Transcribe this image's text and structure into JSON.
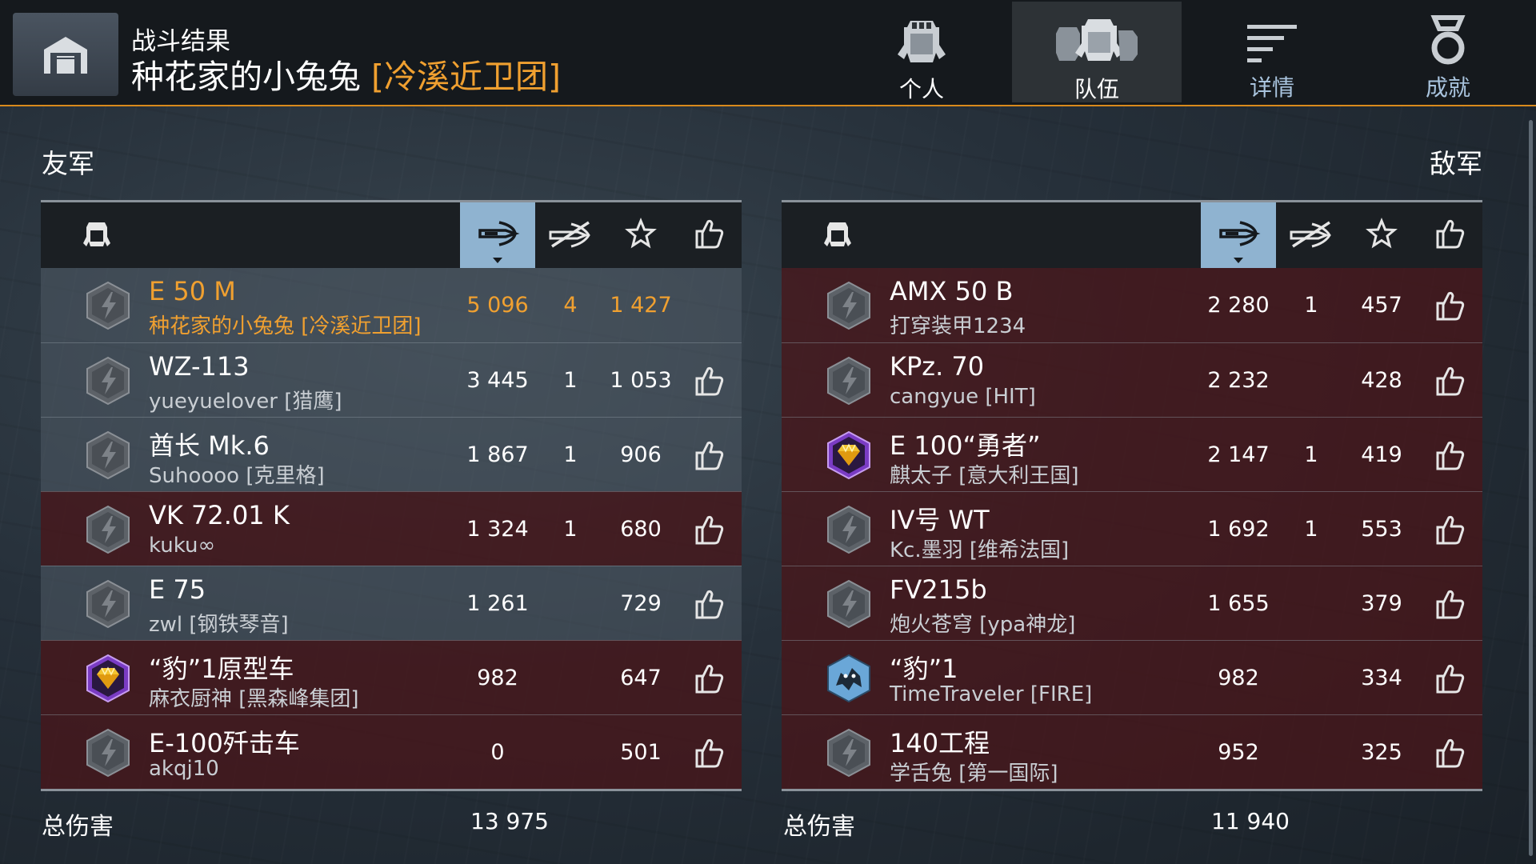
{
  "header": {
    "subtitle": "战斗结果",
    "player_name": "种花家的小兔兔",
    "clan": "[冷溪近卫团]",
    "tabs": [
      {
        "label": "个人",
        "icon": "single-helmet-icon",
        "active": false
      },
      {
        "label": "队伍",
        "icon": "team-helmets-icon",
        "active": true
      },
      {
        "label": "详情",
        "icon": "details-lines-icon",
        "active": false
      },
      {
        "label": "成就",
        "icon": "medal-icon",
        "active": false
      }
    ]
  },
  "allies": {
    "title": "友军",
    "total_label": "总伤害",
    "total_damage": "13 975",
    "rows": [
      {
        "tank": "E 50 M",
        "player": "种花家的小兔兔 [冷溪近卫团]",
        "damage": "5 096",
        "kills": "4",
        "xp": "1 427",
        "like": false,
        "badge": "grey",
        "style": "light",
        "me": true
      },
      {
        "tank": "WZ-113",
        "player": "yueyuelover [猎鹰]",
        "damage": "3 445",
        "kills": "1",
        "xp": "1 053",
        "like": true,
        "badge": "grey",
        "style": "light",
        "me": false
      },
      {
        "tank": "酋长 Mk.6",
        "player": "Suhoooo [克里格]",
        "damage": "1 867",
        "kills": "1",
        "xp": "906",
        "like": true,
        "badge": "grey",
        "style": "light",
        "me": false
      },
      {
        "tank": "VK 72.01 K",
        "player": "kuku∞",
        "damage": "1 324",
        "kills": "1",
        "xp": "680",
        "like": true,
        "badge": "grey",
        "style": "dark",
        "me": false
      },
      {
        "tank": "E 75",
        "player": "zwl [钢铁琴音]",
        "damage": "1 261",
        "kills": "",
        "xp": "729",
        "like": true,
        "badge": "grey",
        "style": "light",
        "me": false
      },
      {
        "tank": "“豹”1原型车",
        "player": "麻衣厨神 [黑森峰集团]",
        "damage": "982",
        "kills": "",
        "xp": "647",
        "like": true,
        "badge": "gold",
        "style": "dark",
        "me": false
      },
      {
        "tank": "E-100歼击车",
        "player": "akqj10",
        "damage": "0",
        "kills": "",
        "xp": "501",
        "like": true,
        "badge": "grey",
        "style": "dark",
        "me": false
      }
    ]
  },
  "enemies": {
    "title": "敌军",
    "total_label": "总伤害",
    "total_damage": "11 940",
    "rows": [
      {
        "tank": "AMX 50 B",
        "player": "打穿装甲1234",
        "damage": "2 280",
        "kills": "1",
        "xp": "457",
        "like": true,
        "badge": "grey",
        "style": "dark",
        "me": false
      },
      {
        "tank": "KPz. 70",
        "player": "cangyue [HIT]",
        "damage": "2 232",
        "kills": "",
        "xp": "428",
        "like": true,
        "badge": "grey",
        "style": "dark",
        "me": false
      },
      {
        "tank": "E 100“勇者”",
        "player": "麒太子 [意大利王国]",
        "damage": "2 147",
        "kills": "1",
        "xp": "419",
        "like": true,
        "badge": "gold",
        "style": "dark",
        "me": false
      },
      {
        "tank": "IV号 WT",
        "player": "Kc.墨羽 [维希法国]",
        "damage": "1 692",
        "kills": "1",
        "xp": "553",
        "like": true,
        "badge": "grey",
        "style": "dark",
        "me": false
      },
      {
        "tank": "FV215b",
        "player": "炮火苍穹 [ypa神龙]",
        "damage": "1 655",
        "kills": "",
        "xp": "379",
        "like": true,
        "badge": "grey",
        "style": "dark",
        "me": false
      },
      {
        "tank": "“豹”1",
        "player": "TimeTraveler [FIRE]",
        "damage": "982",
        "kills": "",
        "xp": "334",
        "like": true,
        "badge": "blue",
        "style": "dark",
        "me": false
      },
      {
        "tank": "140工程",
        "player": "学舌兔 [第一国际]",
        "damage": "952",
        "kills": "",
        "xp": "325",
        "like": true,
        "badge": "grey",
        "style": "dark",
        "me": false
      }
    ]
  },
  "columns": {
    "icons": [
      "tank-helmet-icon",
      "damage-shell-icon",
      "kills-crossed-icon",
      "xp-star-icon",
      "like-thumb-icon"
    ],
    "sorted": "damage"
  },
  "colors": {
    "accent_orange": "#f0a030",
    "header_bg": "#15191d",
    "sorted_column": "#8fb3d0",
    "row_light": "#4e5a64",
    "row_dark": "#48161a"
  }
}
